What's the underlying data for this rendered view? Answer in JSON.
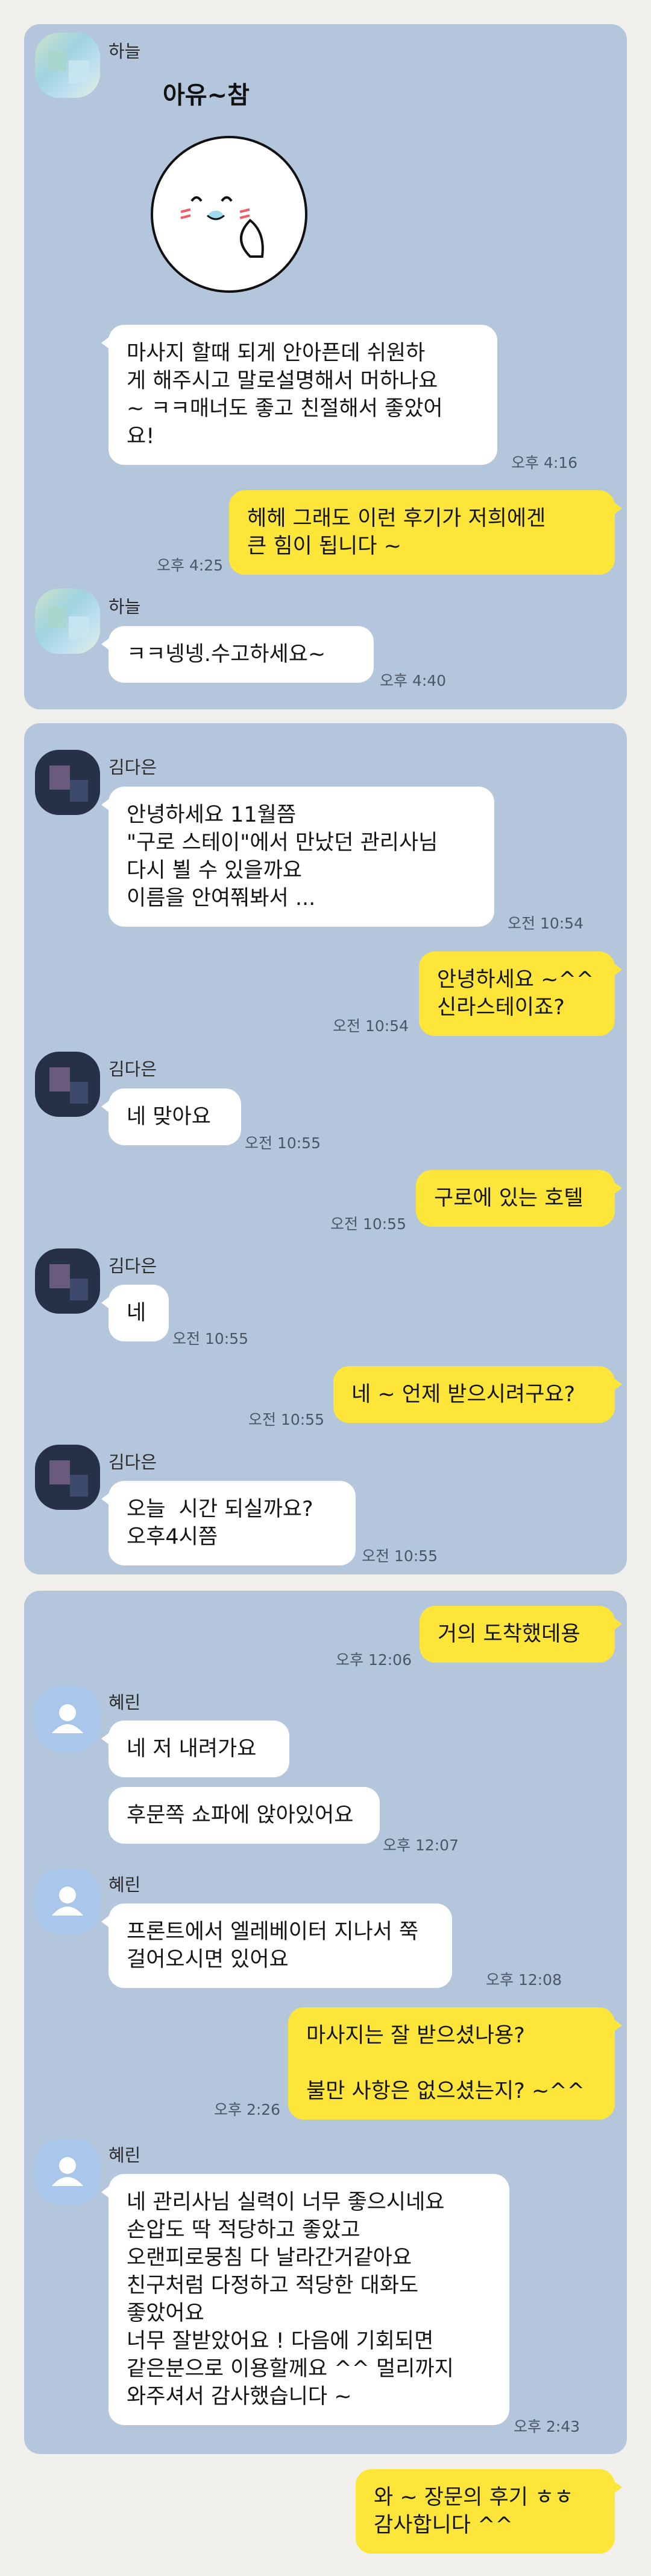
{
  "colors": {
    "background": "#f1efec",
    "panel": "#b3c6dc",
    "incoming_bubble": "#ffffff",
    "outgoing_bubble": "#fde53a",
    "default_avatar": "#a9c7ea"
  },
  "chat1": {
    "sender": "하늘",
    "sticker_text": "아유~참",
    "msg1_lines": [
      "마사지 할때 되게 안아픈데 쉬원하",
      "게 해주시고 말로설명해서 머하나요",
      "~ ㅋㅋ매너도 좋고 친절해서 좋았어",
      "요!"
    ],
    "msg1_time": "오후 4:16",
    "reply1_lines": [
      "헤헤 그래도 이런 후기가 저희에겐",
      "큰 힘이 됩니다 ~"
    ],
    "reply1_time": "오후 4:25",
    "msg2": "ㅋㅋ넹넹.수고하세요~",
    "msg2_time": "오후 4:40"
  },
  "chat2": {
    "sender": "김다은",
    "msg1_lines": [
      "안녕하세요 11월쯤",
      "\"구로 스테이\"에서 만났던 관리사님",
      "다시 뵐 수 있을까요",
      "이름을 안여쭤봐서 ..."
    ],
    "msg1_time": "오전 10:54",
    "reply1_lines": [
      "안녕하세요 ~^^",
      "신라스테이죠?"
    ],
    "reply1_time": "오전 10:54",
    "msg2": "네 맞아요",
    "msg2_time": "오전 10:55",
    "reply2": "구로에 있는 호텔",
    "reply2_time": "오전 10:55",
    "msg3": "네",
    "msg3_time": "오전 10:55",
    "reply3": "네 ~ 언제 받으시려구요?",
    "reply3_time": "오전 10:55",
    "msg4_lines": [
      "오늘  시간 되실까요?",
      "오후4시쯤"
    ],
    "msg4_time": "오전 10:55"
  },
  "chat3": {
    "sender": "혜린",
    "reply1": "거의 도착했데용",
    "reply1_time": "오후 12:06",
    "msg1": "네 저 내려가요",
    "msg2": "후문쪽 쇼파에 앉아있어요",
    "msg2_time": "오후 12:07",
    "msg3_lines": [
      "프론트에서 엘레베이터 지나서 쭉",
      "걸어오시면 있어요"
    ],
    "msg3_time": "오후 12:08",
    "reply2_lines": [
      "마사지는 잘 받으셨나용?",
      "",
      "불만 사항은 없으셨는지? ~^^"
    ],
    "reply2_time": "오후 2:26",
    "msg4_lines": [
      "네 관리사님 실력이 너무 좋으시네요",
      "손압도 딱 적당하고 좋았고",
      "오랜피로뭉침 다 날라간거같아요",
      "친구처럼 다정하고 적당한 대화도",
      "좋았어요",
      "너무 잘받았어요 ! 다음에 기회되면",
      "같은분으로 이용할께요 ^^ 멀리까지",
      "와주셔서 감사했습니다 ~"
    ],
    "msg4_time": "오후 2:43",
    "reply3_lines": [
      "와 ~ 장문의 후기 ㅎㅎ",
      "감사합니다 ^^"
    ]
  }
}
